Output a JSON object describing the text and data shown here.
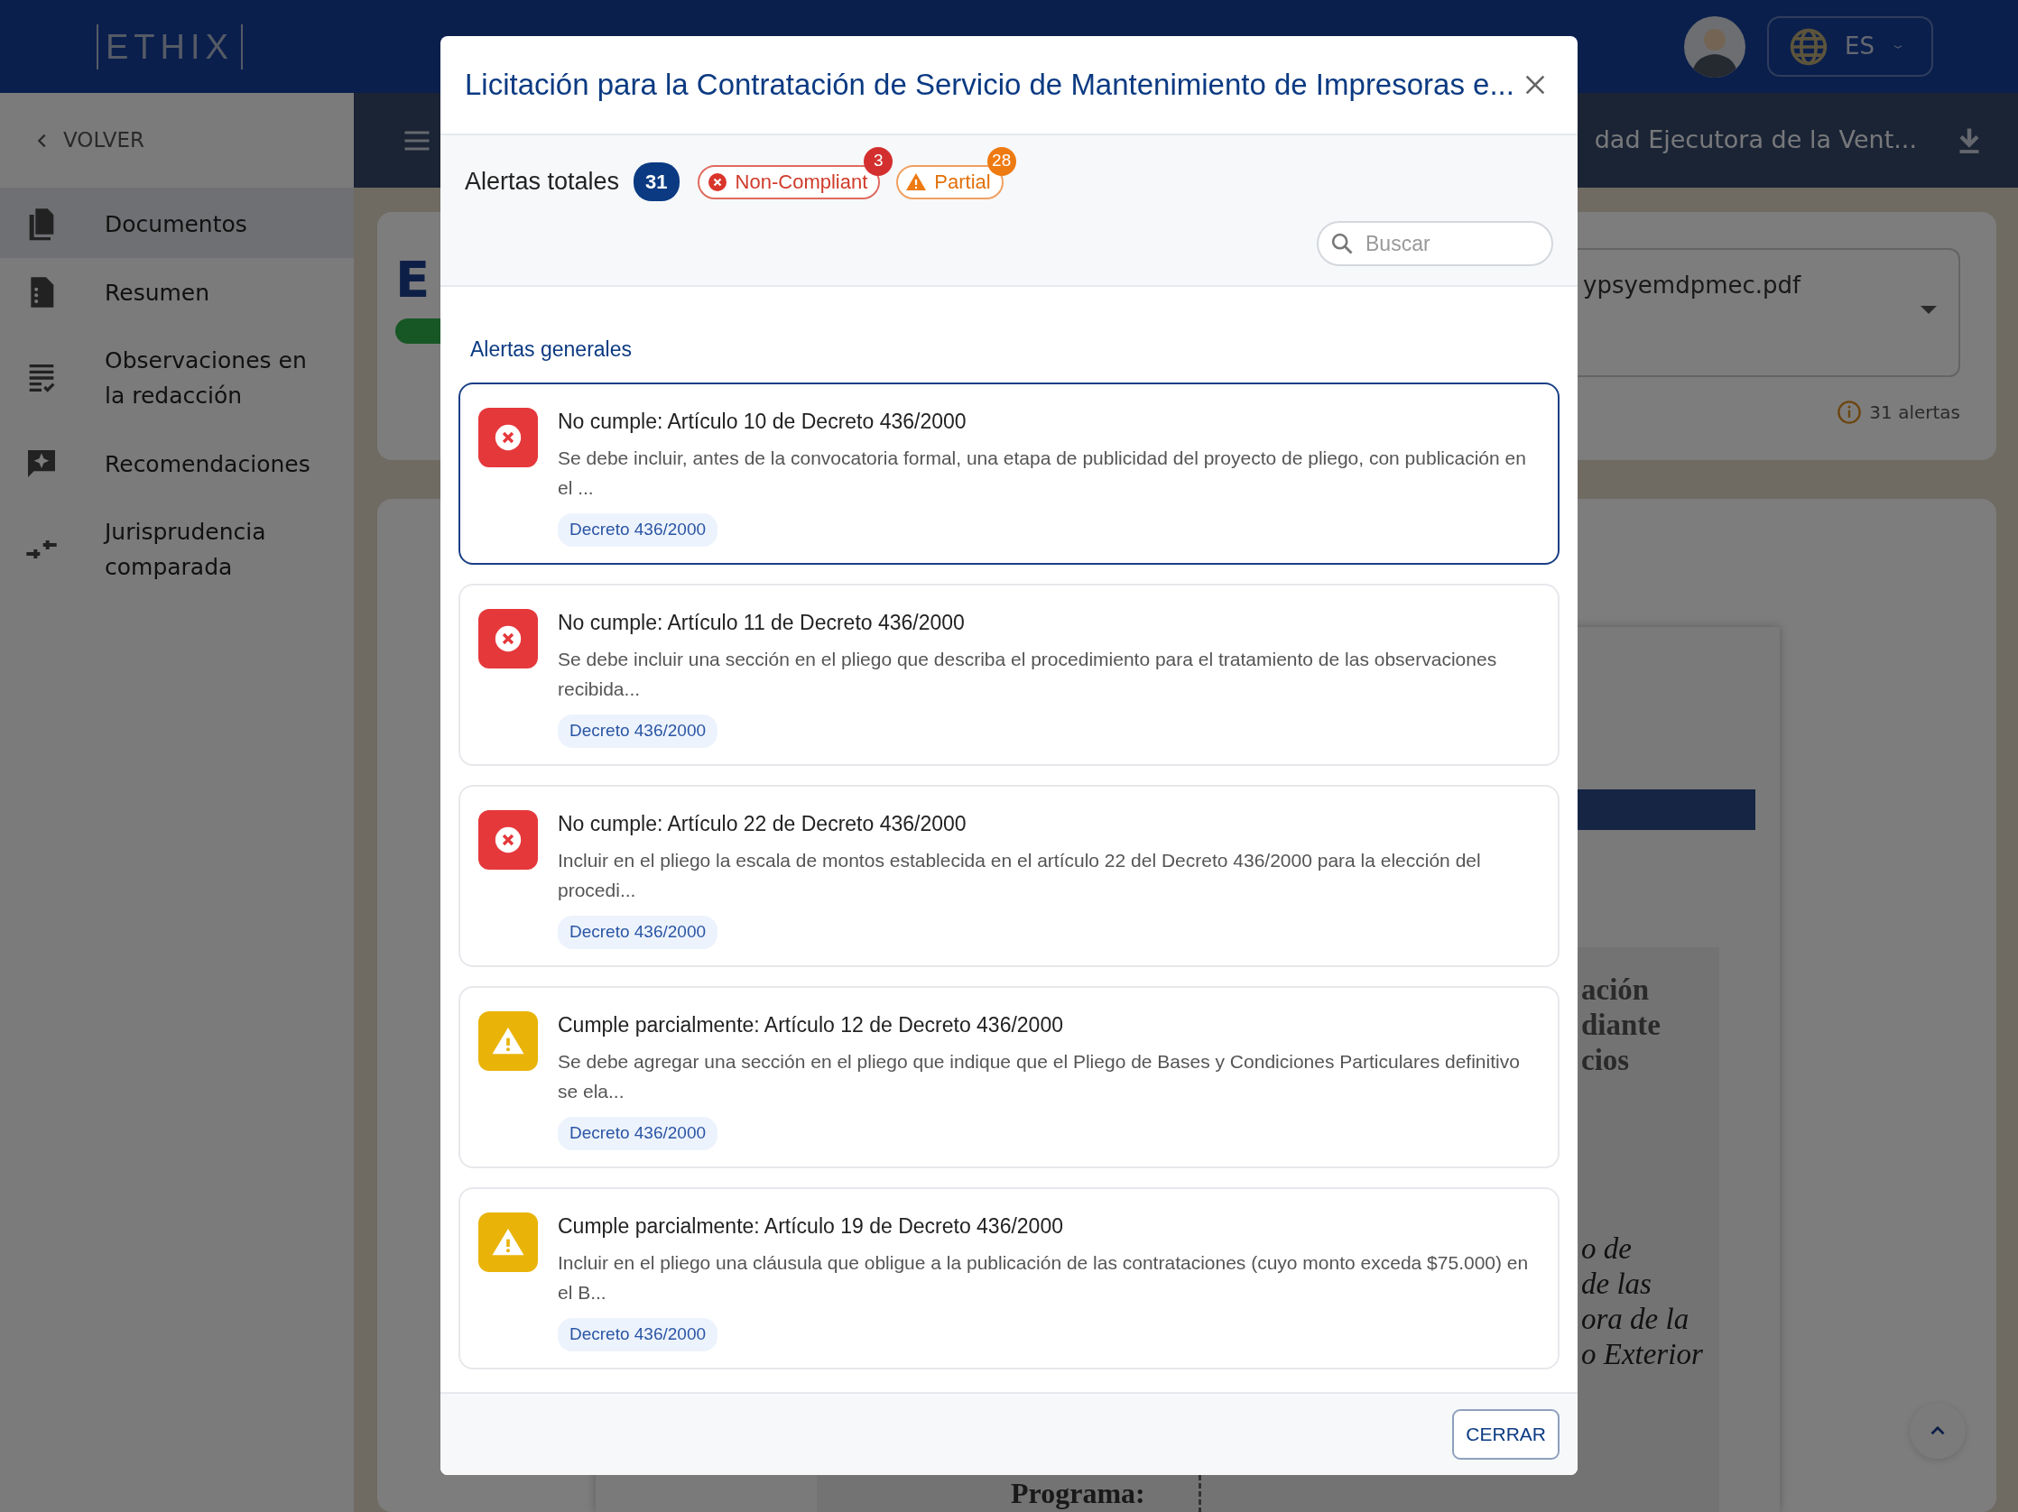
{
  "header": {
    "logo": "ETHIX",
    "language": "ES"
  },
  "sidebar": {
    "back": "VOLVER",
    "items": [
      {
        "label": "Documentos",
        "selected": true
      },
      {
        "label": "Resumen",
        "selected": false
      },
      {
        "label": "Observaciones en la redacción",
        "selected": false
      },
      {
        "label": "Recomendaciones",
        "selected": false
      },
      {
        "label": "Jurisprudencia comparada",
        "selected": false
      }
    ]
  },
  "subheader": {
    "title": "dad Ejecutora de la Vent..."
  },
  "document_card": {
    "initial": "E",
    "file": "ypsyemdpmec.pdf",
    "alerts": "31 alertas"
  },
  "document_preview": {
    "bold_lines": [
      "ación",
      "diante",
      "cios"
    ],
    "italic_lines": [
      "o de",
      "de las",
      "ora de la",
      "o Exterior"
    ],
    "footer": "Programa:"
  },
  "modal": {
    "title": "Licitación para la Contratación de Servicio de Mantenimiento de Impresoras e...",
    "total_label": "Alertas totales",
    "total": "31",
    "filters": [
      {
        "kind": "non_compliant",
        "label": "Non-Compliant",
        "count": "3"
      },
      {
        "kind": "partial",
        "label": "Partial",
        "count": "28"
      }
    ],
    "search": {
      "placeholder": "Buscar"
    },
    "section": "Alertas generales",
    "alerts": [
      {
        "kind": "non_compliant",
        "selected": true,
        "title": "No cumple: Artículo 10 de Decreto 436/2000",
        "description": "Se debe incluir, antes de la convocatoria formal, una etapa de publicidad del proyecto de pliego, con publicación en el ...",
        "tag": "Decreto 436/2000"
      },
      {
        "kind": "non_compliant",
        "selected": false,
        "title": "No cumple: Artículo 11 de Decreto 436/2000",
        "description": "Se debe incluir una sección en el pliego que describa el procedimiento para el tratamiento de las observaciones recibida...",
        "tag": "Decreto 436/2000"
      },
      {
        "kind": "non_compliant",
        "selected": false,
        "title": "No cumple: Artículo 22 de Decreto 436/2000",
        "description": "Incluir en el pliego la escala de montos establecida en el artículo 22 del Decreto 436/2000 para la elección del procedi...",
        "tag": "Decreto 436/2000"
      },
      {
        "kind": "partial",
        "selected": false,
        "title": "Cumple parcialmente: Artículo 12 de Decreto 436/2000",
        "description": "Se debe agregar una sección en el pliego que indique que el Pliego de Bases y Condiciones Particulares definitivo se ela...",
        "tag": "Decreto 436/2000"
      },
      {
        "kind": "partial",
        "selected": false,
        "title": "Cumple parcialmente: Artículo 19 de Decreto 436/2000",
        "description": "Incluir en el pliego una cláusula que obligue a la publicación de las contrataciones (cuyo monto exceda $75.000) en el B...",
        "tag": "Decreto 436/2000"
      }
    ],
    "close_button": "CERRAR"
  }
}
